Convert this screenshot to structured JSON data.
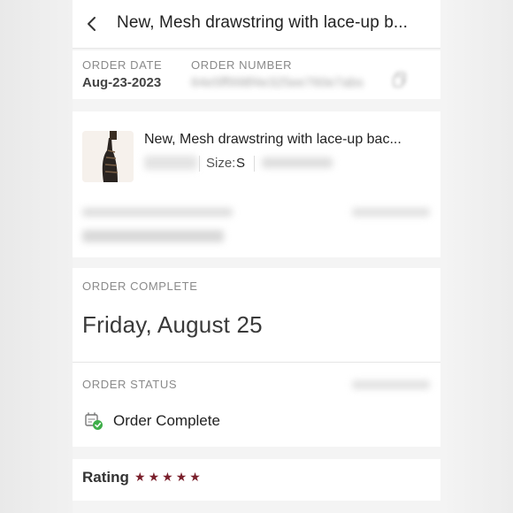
{
  "header": {
    "title": "New, Mesh drawstring with lace-up b...",
    "back_icon": "chevron-left-icon"
  },
  "order_info": {
    "date_label": "ORDER DATE",
    "date_value": "Aug-23-2023",
    "number_label": "ORDER NUMBER",
    "number_value": "64e5ff998f4e325ee760e7abs",
    "copy_icon": "copy-icon"
  },
  "item": {
    "title": "New, Mesh drawstring with lace-up bac...",
    "size_label": "Size:",
    "size_value": "S",
    "thumbnail_icon": "dress-thumbnail"
  },
  "order_complete": {
    "label": "ORDER COMPLETE",
    "date": "Friday, August 25"
  },
  "order_status": {
    "label": "ORDER STATUS",
    "value": "Order Complete",
    "icon": "order-complete-icon"
  },
  "rating": {
    "label": "Rating",
    "stars": 5,
    "max_stars": 5,
    "star_color": "#7a1f2b"
  },
  "colors": {
    "text_primary": "#222222",
    "label_gray": "#8a8a8a",
    "check_green": "#3fae4a",
    "star_maroon": "#7a1f2b"
  }
}
